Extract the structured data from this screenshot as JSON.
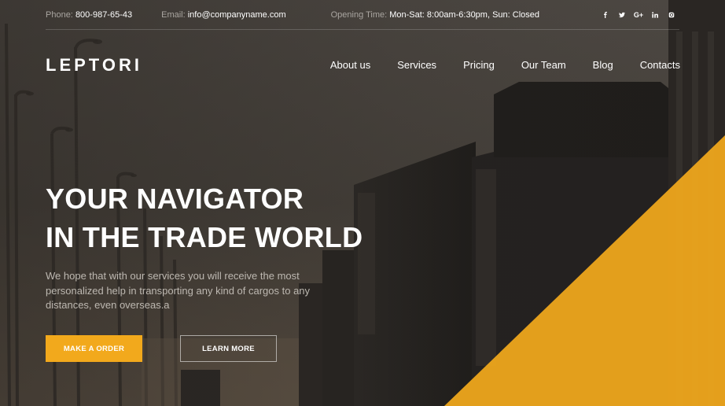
{
  "topbar": {
    "phone_label": "Phone:",
    "phone_value": "800-987-65-43",
    "email_label": "Email:",
    "email_value": "info@companyname.com",
    "hours_label": "Opening Time:",
    "hours_value": "Mon-Sat: 8:00am-6:30pm, Sun: Closed",
    "socials": [
      "facebook-icon",
      "twitter-icon",
      "google-plus-icon",
      "linkedin-icon",
      "instagram-icon"
    ]
  },
  "brand": {
    "logo": "LEPTORI"
  },
  "nav": {
    "items": [
      "About us",
      "Services",
      "Pricing",
      "Our Team",
      "Blog",
      "Contacts"
    ]
  },
  "hero": {
    "headline_line1": "YOUR NAVIGATOR",
    "headline_line2": "IN THE TRADE WORLD",
    "description": "We hope that with our services you will receive the most personalized help in transporting any kind of cargos to any distances, even overseas.a",
    "primary_button": "MAKE A ORDER",
    "secondary_button": "LEARN MORE"
  },
  "colors": {
    "accent": "#f2a91c",
    "text": "#ffffff",
    "muted": "#bdb8b1"
  }
}
